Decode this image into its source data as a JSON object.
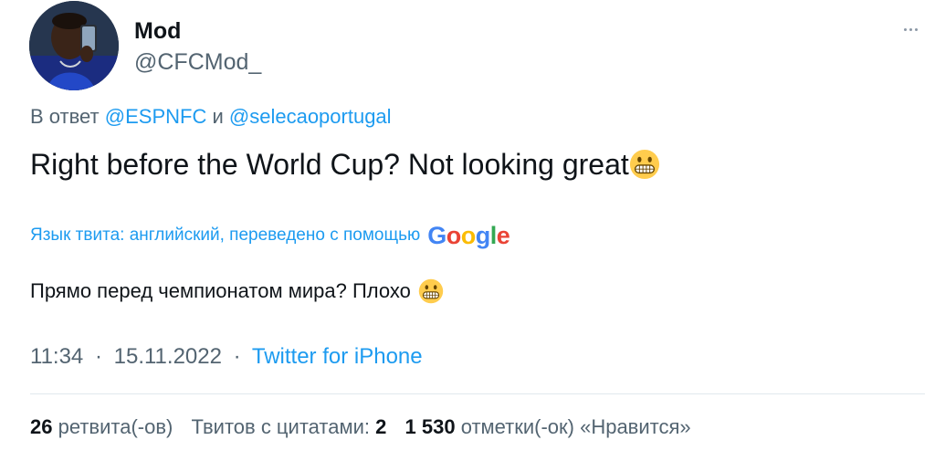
{
  "author": {
    "display_name": "Mod",
    "handle": "@CFCMod_"
  },
  "reply": {
    "prefix": "В ответ",
    "mention1": "@ESPNFC",
    "conj": "и",
    "mention2": "@selecaoportugal"
  },
  "tweet": {
    "text": "Right before the World Cup? Not looking great",
    "emoji": "grimacing-face"
  },
  "translation": {
    "notice": "Язык твита: английский, переведено с помощью",
    "provider": "Google",
    "text": "Прямо перед чемпионатом мира? Плохо"
  },
  "meta": {
    "time": "11:34",
    "separator": "·",
    "date": "15.11.2022",
    "source": "Twitter for iPhone"
  },
  "stats": {
    "retweets_count": "26",
    "retweets_label": "ретвита(-ов)",
    "quotes_label": "Твитов с цитатами:",
    "quotes_count": "2",
    "likes_count": "1 530",
    "likes_label": "отметки(-ок) «Нравится»"
  },
  "colors": {
    "link": "#1d9bf0",
    "secondary": "#536471",
    "primary": "#0f1419"
  }
}
